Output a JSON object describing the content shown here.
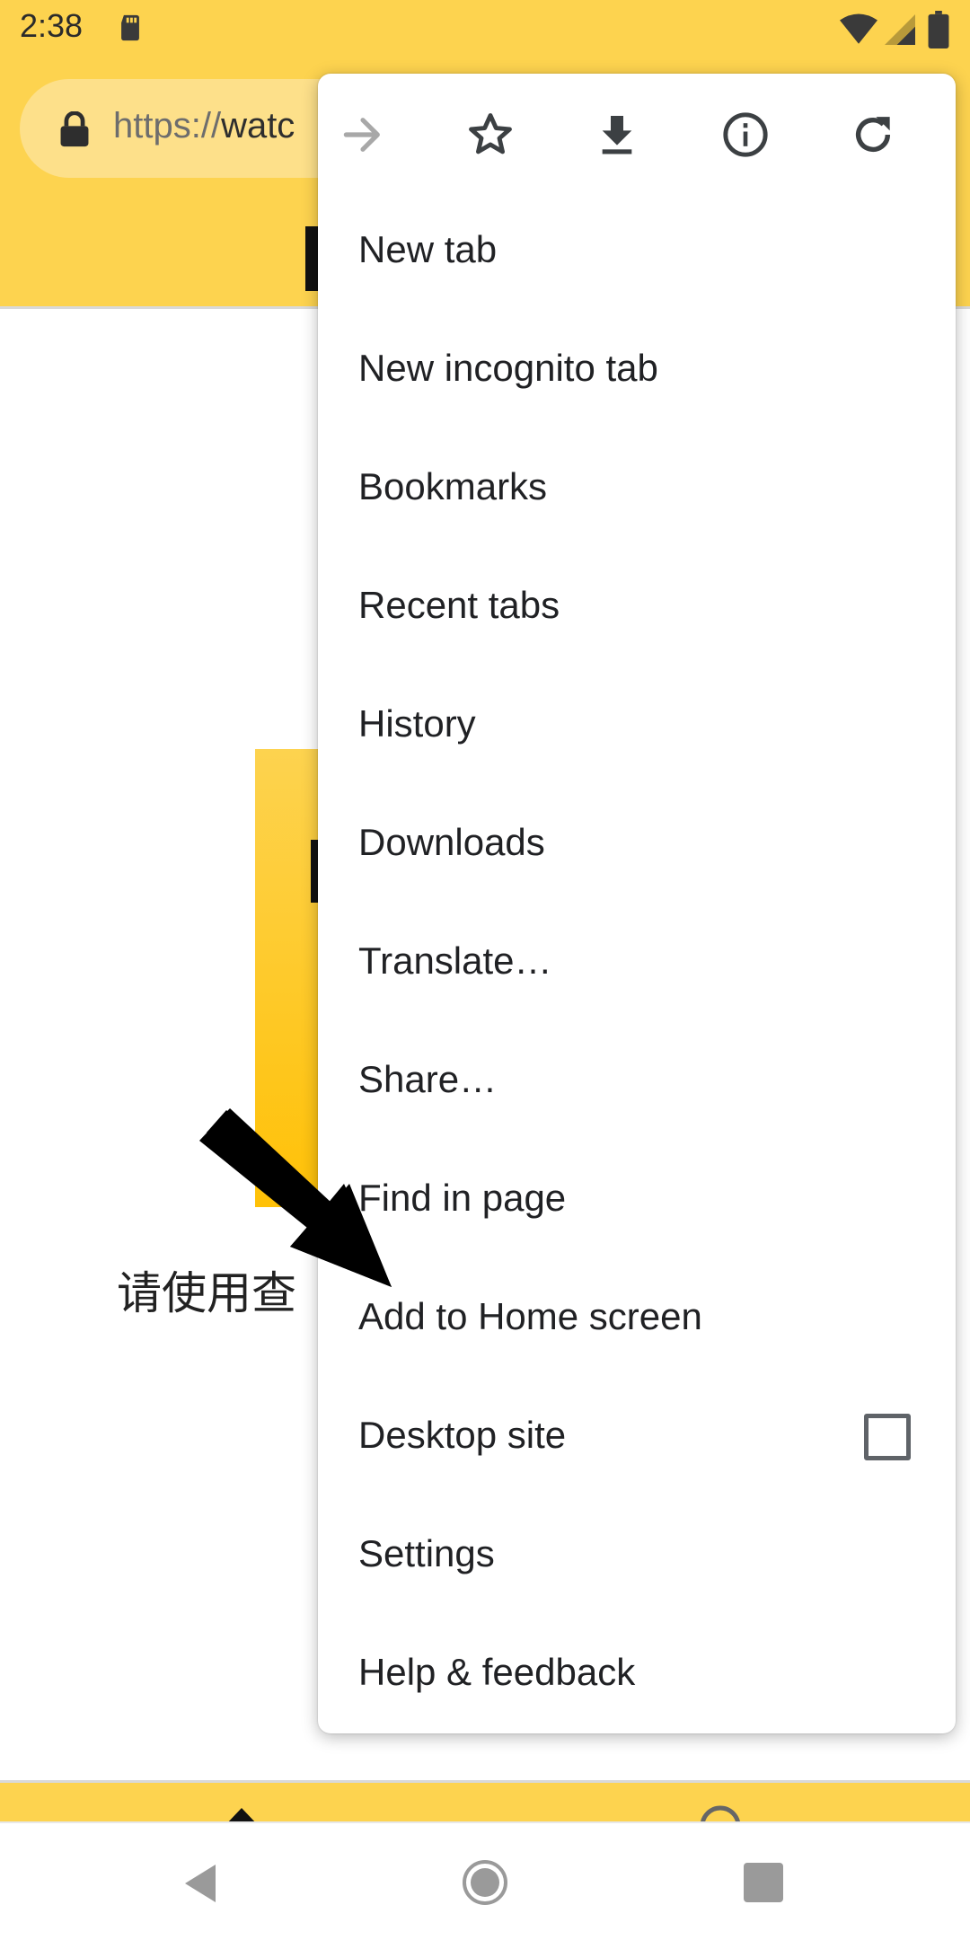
{
  "status_bar": {
    "time": "2:38"
  },
  "toolbar": {
    "url_scheme": "https://",
    "url_host": "watc"
  },
  "page": {
    "text": "请使用查"
  },
  "menu": {
    "items": [
      {
        "label": "New tab"
      },
      {
        "label": "New incognito tab"
      },
      {
        "label": "Bookmarks"
      },
      {
        "label": "Recent tabs"
      },
      {
        "label": "History"
      },
      {
        "label": "Downloads"
      },
      {
        "label": "Translate…"
      },
      {
        "label": "Share…"
      },
      {
        "label": "Find in page"
      },
      {
        "label": "Add to Home screen"
      },
      {
        "label": "Desktop site",
        "checked": false
      },
      {
        "label": "Settings"
      },
      {
        "label": "Help & feedback"
      }
    ],
    "icons": [
      "forward-icon",
      "bookmark-star-icon",
      "download-icon",
      "info-icon",
      "refresh-icon"
    ]
  },
  "colors": {
    "toolbar": "#fdd34f",
    "url_pill": "#fde08a",
    "menu_text": "#202124",
    "forward_disabled": "#a8a8a8",
    "icon": "#3c4043"
  }
}
